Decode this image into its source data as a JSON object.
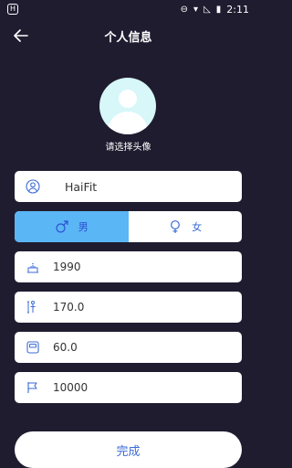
{
  "status_bar": {
    "time": "2:11",
    "app_logo": "H",
    "battery_icon": "battery-charging-icon"
  },
  "header": {
    "title": "个人信息",
    "back_icon": "arrow-left-icon"
  },
  "avatar": {
    "caption": "请选择头像",
    "icon": "avatar-placeholder-icon"
  },
  "form": {
    "name": {
      "value": "HaiFit",
      "icon": "user-icon"
    },
    "gender": {
      "selected": "男",
      "options": [
        {
          "label": "男",
          "icon": "male-icon",
          "active": true
        },
        {
          "label": "女",
          "icon": "female-icon",
          "active": false
        }
      ]
    },
    "birth_year": {
      "value": "1990",
      "icon": "cake-icon"
    },
    "height": {
      "value": "170.0",
      "icon": "height-icon"
    },
    "weight": {
      "value": "60.0",
      "icon": "scale-icon"
    },
    "goal": {
      "value": "10000",
      "icon": "flag-icon"
    }
  },
  "done_button": {
    "label": "完成"
  },
  "colors": {
    "background": "#201c30",
    "accent": "#5ab6f5",
    "primary_text": "#3b6bd6"
  }
}
